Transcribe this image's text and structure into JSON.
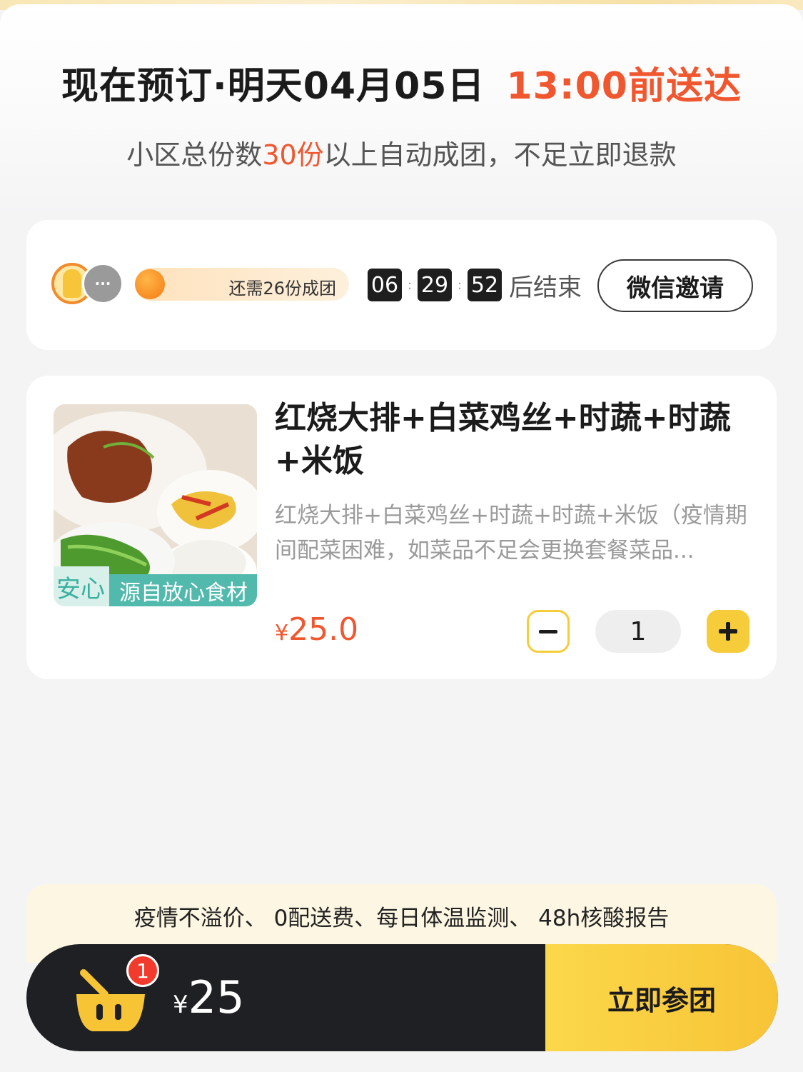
{
  "header": {
    "title_prefix": "现在预订·明天04月05日",
    "title_deliver": "13:00前送达",
    "subtitle_pre": "小区总份数",
    "subtitle_highlight": "30份",
    "subtitle_post": "以上自动成团，不足立即退款"
  },
  "group": {
    "avatars": [
      "mascot-avatar",
      "more-avatar"
    ],
    "more_label": "···",
    "progress_text": "还需26份成团",
    "timer": {
      "hours": "06",
      "minutes": "29",
      "seconds": "52",
      "sep": ":",
      "suffix": "后结束"
    },
    "invite_label": "微信邀请"
  },
  "product": {
    "title": "红烧大排+白菜鸡丝+时蔬+时蔬+米饭",
    "description": "红烧大排+白菜鸡丝+时蔬+时蔬+米饭（疫情期间配菜困难，如菜品不足会更换套餐菜品...",
    "image_tag_left": "安心",
    "image_tag_right": "源自放心食材",
    "price_symbol": "¥",
    "price": "25.0",
    "quantity": "1"
  },
  "promo": {
    "text": "疫情不溢价、 0配送费、每日体温监测、 48h核酸报告"
  },
  "checkout": {
    "cart_badge": "1",
    "total_symbol": "¥",
    "total": "25",
    "join_label": "立即参团"
  },
  "colors": {
    "accent_orange": "#f1572f",
    "accent_yellow": "#f7cc3a",
    "checkout_bg": "#1f2023"
  }
}
